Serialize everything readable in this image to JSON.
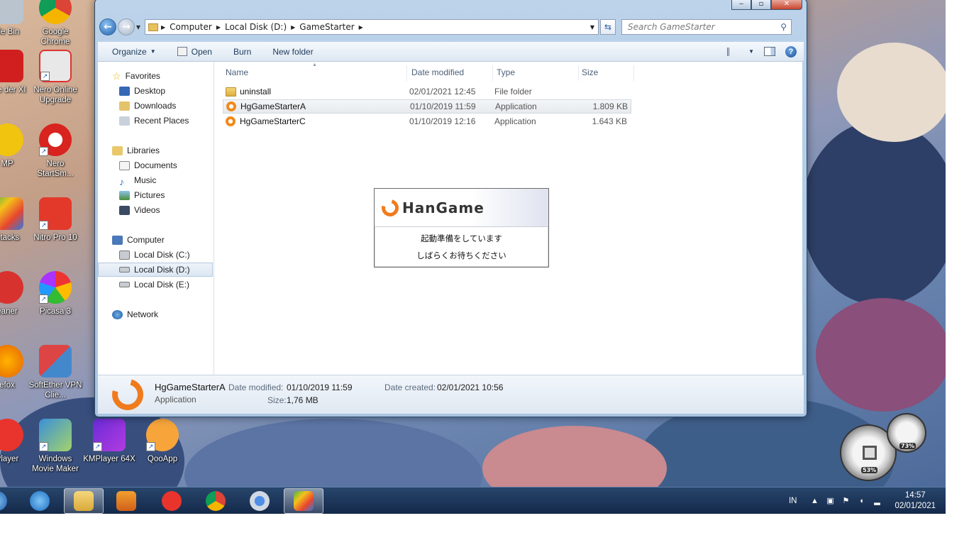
{
  "desktop": {
    "icons": [
      {
        "label": "cle Bin"
      },
      {
        "label": "Google Chrome"
      },
      {
        "label": "obe der XI"
      },
      {
        "label": "Nero Online Upgrade"
      },
      {
        "label": "MP"
      },
      {
        "label": "Nero StartSm..."
      },
      {
        "label": "Stacks"
      },
      {
        "label": "Nitro Pro 10"
      },
      {
        "label": "eaner"
      },
      {
        "label": "Picasa 3"
      },
      {
        "label": "efox"
      },
      {
        "label": "SoftEther VPN Clie..."
      },
      {
        "label": "Player"
      },
      {
        "label": "Windows Movie Maker"
      },
      {
        "label": "KMPlayer 64X"
      },
      {
        "label": "QooApp"
      }
    ]
  },
  "window": {
    "address": {
      "crumbs": [
        "Computer",
        "Local Disk (D:)",
        "GameStarter"
      ]
    },
    "search_placeholder": "Search GameStarter",
    "toolbar": {
      "organize": "Organize",
      "open": "Open",
      "burn": "Burn",
      "new_folder": "New folder"
    },
    "nav": {
      "favorites": "Favorites",
      "desktop": "Desktop",
      "downloads": "Downloads",
      "recent": "Recent Places",
      "libraries": "Libraries",
      "documents": "Documents",
      "music": "Music",
      "pictures": "Pictures",
      "videos": "Videos",
      "computer": "Computer",
      "disk_c": "Local Disk (C:)",
      "disk_d": "Local Disk (D:)",
      "disk_e": "Local Disk (E:)",
      "network": "Network"
    },
    "columns": {
      "name": "Name",
      "date": "Date modified",
      "type": "Type",
      "size": "Size"
    },
    "files": [
      {
        "name": "uninstall",
        "date": "02/01/2021 12:45",
        "type": "File folder",
        "size": ""
      },
      {
        "name": "HgGameStarterA",
        "date": "01/10/2019 11:59",
        "type": "Application",
        "size": "1.809 KB"
      },
      {
        "name": "HgGameStarterC",
        "date": "01/10/2019 12:16",
        "type": "Application",
        "size": "1.643 KB"
      }
    ],
    "details": {
      "name": "HgGameStarterA",
      "kind": "Application",
      "modified_label": "Date modified:",
      "modified_value": "01/10/2019 11:59",
      "size_label": "Size:",
      "size_value": "1,76 MB",
      "created_label": "Date created:",
      "created_value": "02/01/2021 10:56"
    }
  },
  "hangame_dialog": {
    "logo": "HanGame",
    "line1": "起動準備をしています",
    "line2": "しばらくお待ちください"
  },
  "gauges": {
    "cpu": "53%",
    "memory": "73%"
  },
  "taskbar": {
    "lang": "IN",
    "time": "14:57",
    "date": "02/01/2021"
  },
  "colors": {
    "accent": "#f07b1d",
    "taskbar": "#1b3358",
    "selection": "#dce7f3"
  }
}
